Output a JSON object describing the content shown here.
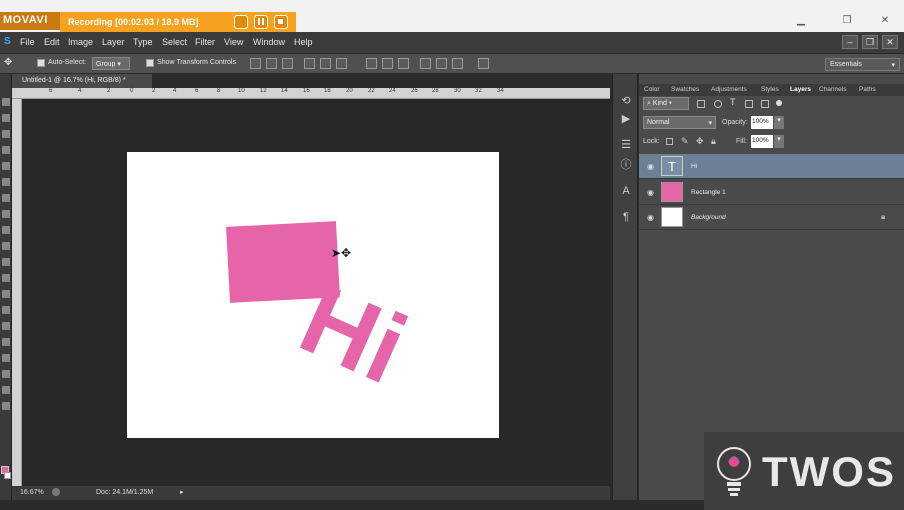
{
  "recorder": {
    "brand": "MOVAVI",
    "status_text": "Recording  [00:02:03 / 18.9 MB]"
  },
  "menubar": {
    "items": [
      "File",
      "Edit",
      "Image",
      "Layer",
      "Type",
      "Select",
      "Filter",
      "View",
      "Window",
      "Help"
    ]
  },
  "options": {
    "auto_select_label": "Auto-Select:",
    "auto_select_value": "Group",
    "show_transform_label": "Show Transform Controls",
    "workspace": "Essentials"
  },
  "document": {
    "tab_title": "Untitled-1 @ 16.7% (Hi, RGB/8) *",
    "ruler_ticks": [
      "6",
      "4",
      "2",
      "0",
      "2",
      "4",
      "6",
      "8",
      "10",
      "12",
      "14",
      "16",
      "18",
      "20",
      "22",
      "24",
      "26",
      "28",
      "30",
      "32",
      "34"
    ],
    "canvas_text": "Hi"
  },
  "status": {
    "zoom": "16.67%",
    "doc_size": "Doc: 24.1M/1.25M"
  },
  "panel": {
    "tabs": [
      "Color",
      "Swatches",
      "Adjustments",
      "Styles",
      "Layers",
      "Channels",
      "Paths"
    ],
    "active_tab": "Layers",
    "filter_kind": "Kind",
    "blend_mode": "Normal",
    "opacity_label": "Opacity:",
    "opacity_value": "100%",
    "lock_label": "Lock:",
    "fill_label": "Fill:",
    "fill_value": "100%",
    "layers": [
      {
        "name": "Hi",
        "type": "text",
        "selected": true
      },
      {
        "name": "Rectangle 1",
        "type": "shape",
        "selected": false
      },
      {
        "name": "Background",
        "type": "background",
        "selected": false
      }
    ]
  },
  "watermark": {
    "text": "TWOS"
  },
  "colors": {
    "accent_pink": "#e565a8",
    "recording_orange": "#f4a21f",
    "selected_layer": "#6d7f95"
  }
}
